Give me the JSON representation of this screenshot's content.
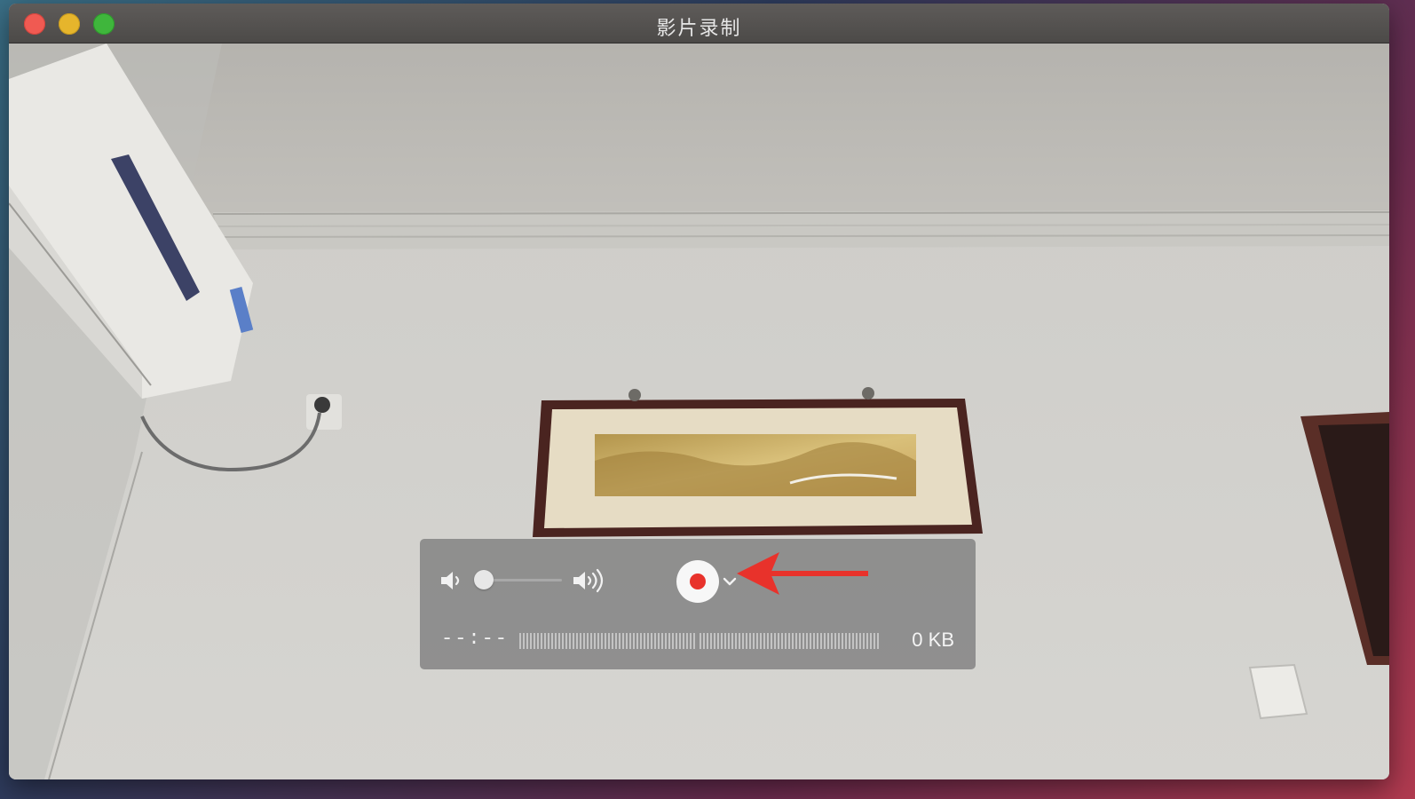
{
  "window": {
    "title": "影片录制"
  },
  "controls": {
    "volume": {
      "level": 0.0
    },
    "elapsed": "--:--",
    "file_size": "0 KB"
  },
  "icons": {
    "close": "close-button",
    "minimize": "minimize-button",
    "zoom": "zoom-button",
    "volume_low": "speaker-low-icon",
    "volume_high": "speaker-high-icon",
    "record": "record-icon",
    "options": "chevron-down-icon",
    "annotation": "red-arrow-icon"
  },
  "colors": {
    "record_red": "#e8322b",
    "annotation_arrow": "#e8322b",
    "hud_bg": "#808080"
  }
}
